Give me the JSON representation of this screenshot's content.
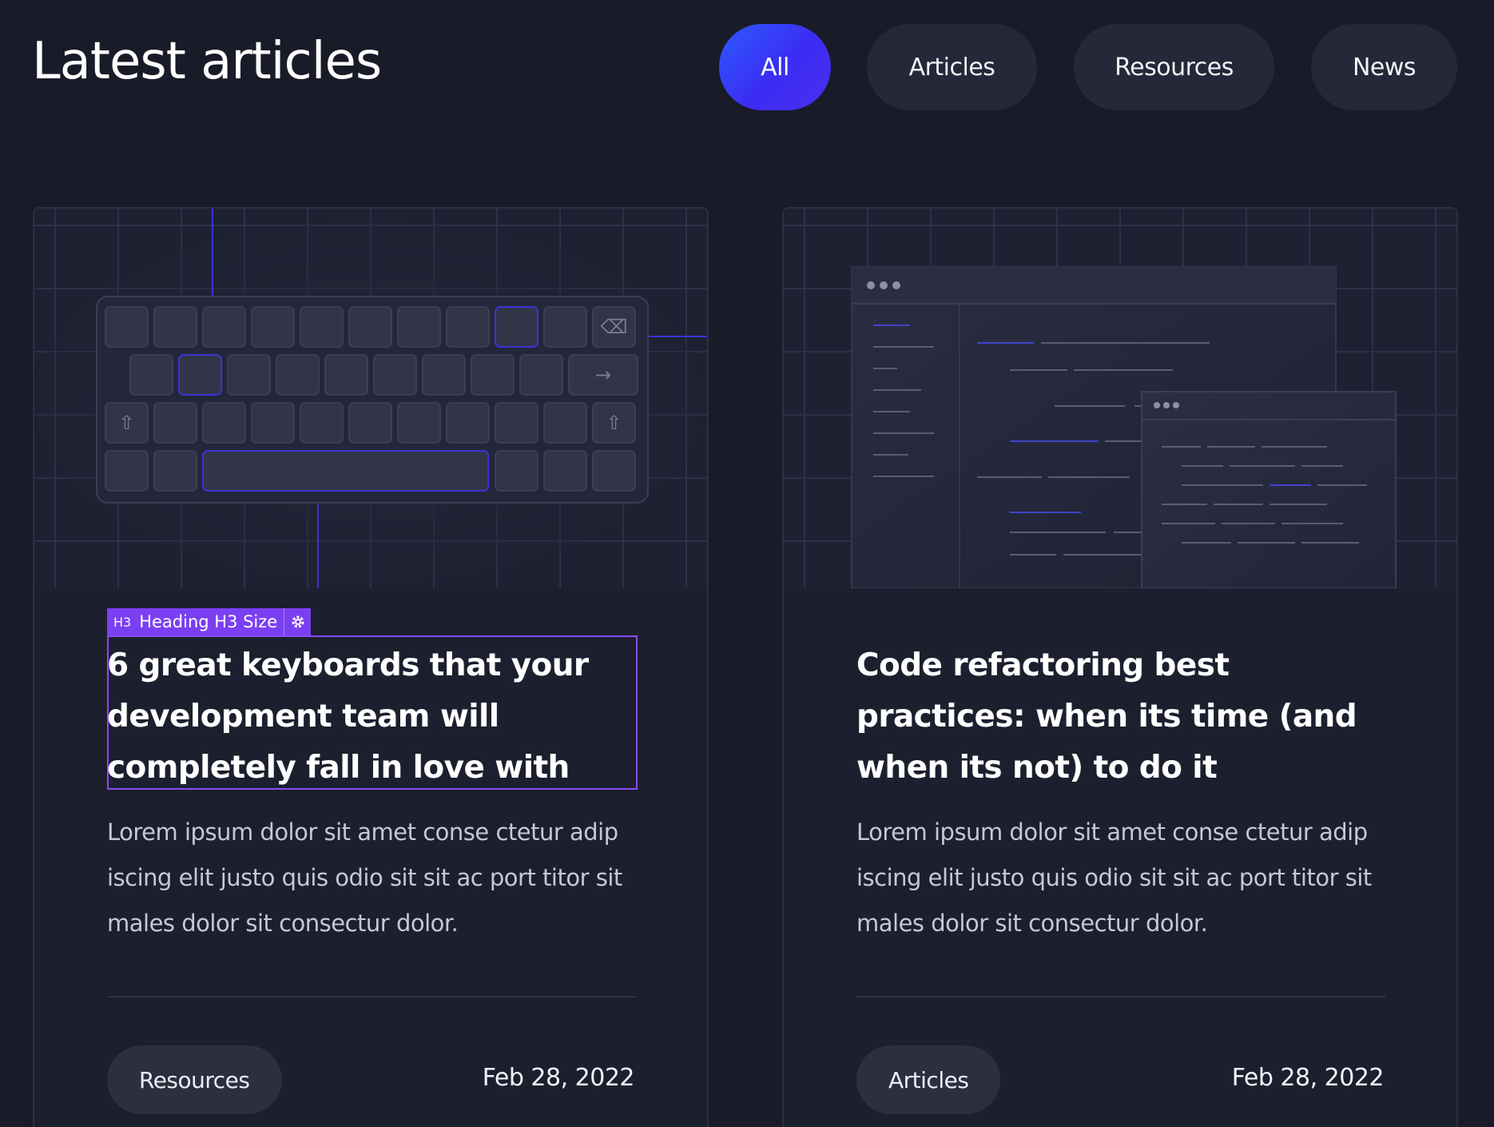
{
  "header": {
    "title": "Latest articles"
  },
  "filters": [
    {
      "label": "All",
      "active": true
    },
    {
      "label": "Articles",
      "active": false
    },
    {
      "label": "Resources",
      "active": false
    },
    {
      "label": "News",
      "active": false
    }
  ],
  "editor_badge": {
    "tag": "H3",
    "label": "Heading H3 Size",
    "icon": "gear-icon"
  },
  "cards": [
    {
      "image": "keyboard-illustration",
      "title": "6 great keyboards that your development team will completely fall in love with",
      "excerpt": "Lorem ipsum dolor sit amet conse ctetur adip iscing elit justo quis odio sit sit ac port titor sit males dolor sit consectur dolor.",
      "category": "Resources",
      "date": "Feb 28, 2022"
    },
    {
      "image": "code-editor-illustration",
      "title": "Code refactoring best practices: when its time (and when its not) to do it",
      "excerpt": "Lorem ipsum dolor sit amet conse ctetur adip iscing elit justo quis odio sit sit ac port titor sit males dolor sit consectur dolor.",
      "category": "Articles",
      "date": "Feb 28, 2022"
    }
  ],
  "colors": {
    "background": "#191b28",
    "card": "#1c1f2e",
    "accent": "#3b2cf2",
    "editor": "#7b3ff2"
  }
}
